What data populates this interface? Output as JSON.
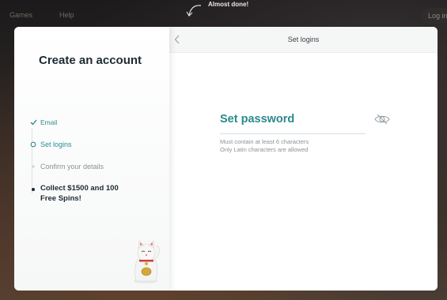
{
  "topnav": {
    "games": "Games",
    "help": "Help",
    "login": "Log in"
  },
  "banner": {
    "text": "Almost done!"
  },
  "modal": {
    "title": "Create an account",
    "steps": [
      {
        "label": "Email",
        "state": "done",
        "icon": "check-icon"
      },
      {
        "label": "Set logins",
        "state": "current",
        "icon": "ring-icon"
      },
      {
        "label": "Confirm your details",
        "state": "pending",
        "icon": "dot-icon"
      },
      {
        "label": "Collect $1500 and 100 Free Spins!",
        "state": "reward",
        "icon": "dot-icon"
      }
    ],
    "header": {
      "title": "Set logins"
    },
    "password": {
      "label": "Set password",
      "value": "",
      "hint1": "Must contain at least 6 characters",
      "hint2": "Only Latin characters are allowed"
    }
  },
  "colors": {
    "accent": "#2b8a8c",
    "dark": "#1d2a33",
    "muted": "#8c9196"
  }
}
